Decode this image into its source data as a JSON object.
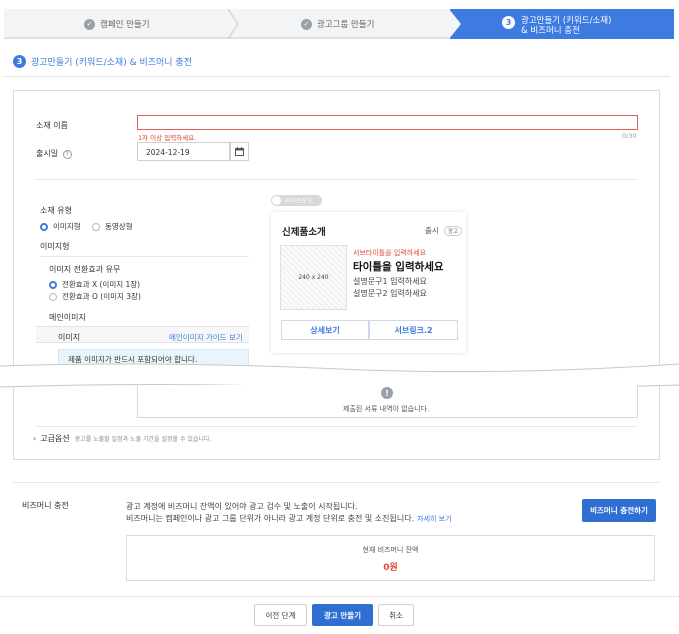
{
  "stepper": {
    "step1": "캠페인 만들기",
    "step2": "광고그룹 만들기",
    "step3_number": "3",
    "step3_line1": "광고만들기 (키워드/소재)",
    "step3_line2": "& 비즈머니 충전"
  },
  "section": {
    "number": "3",
    "title": "광고만들기 (키워드/소재) & 비즈머니 충전"
  },
  "form": {
    "name_label": "소재 이름",
    "name_value": "",
    "name_error": "1자 이상 입력하세요.",
    "name_counter": "0/30",
    "launch_label": "출시일",
    "launch_date": "2024-12-19",
    "type_label": "소재 유형",
    "type_options": [
      "이미지형",
      "동영상형"
    ],
    "image_type_label": "이미지형",
    "conversion_label": "이미지 전환효과 유무",
    "conversion_options": [
      "전환효과 X (이미지 1장)",
      "전환효과 O (이미지 3장)"
    ],
    "main_image_label": "메인이미지",
    "image_label": "이미지",
    "guide_link": "메인이미지 가이드 보기",
    "notice": "제품 이미지가 반드시 포함되어야 합니다."
  },
  "preview": {
    "mode_toggle": "라이트모드",
    "title": "신제품소개",
    "launch": "출시",
    "ad_badge": "광고",
    "image_size": "240 x 240",
    "subtitle": "서브타이틀을 입력하세요",
    "headline": "타이틀을 입력하세요",
    "desc1": "설명문구1 입력하세요",
    "desc2": "설명문구2 입력하세요",
    "button1": "상세보기",
    "button2": "서브링크.2"
  },
  "documents": {
    "empty_text": "제출된 서류 내역이 없습니다."
  },
  "advanced": {
    "title": "고급옵션",
    "description": "광고를 노출할 일정과 노출 기간을 설정할 수 있습니다."
  },
  "bizmoney": {
    "label": "비즈머니 충전",
    "desc1": "광고 계정에 비즈머니 잔액이 있어야 광고 검수 및 노출이 시작됩니다.",
    "desc2": "비즈머니는 캠페인이나 광고 그룹 단위가 아니라 광고 계정 단위로 충전 및 소진됩니다.",
    "more_link": "자세히 보기",
    "charge_button": "비즈머니 충전하기",
    "balance_label": "현재 비즈머니 잔액",
    "balance_value": "0원"
  },
  "footer": {
    "prev": "이전 단계",
    "create": "광고 만들기",
    "cancel": "취소"
  },
  "colors": {
    "accent": "#3e7be0",
    "primary_button": "#2e6fd1",
    "error": "#e04a3a"
  }
}
